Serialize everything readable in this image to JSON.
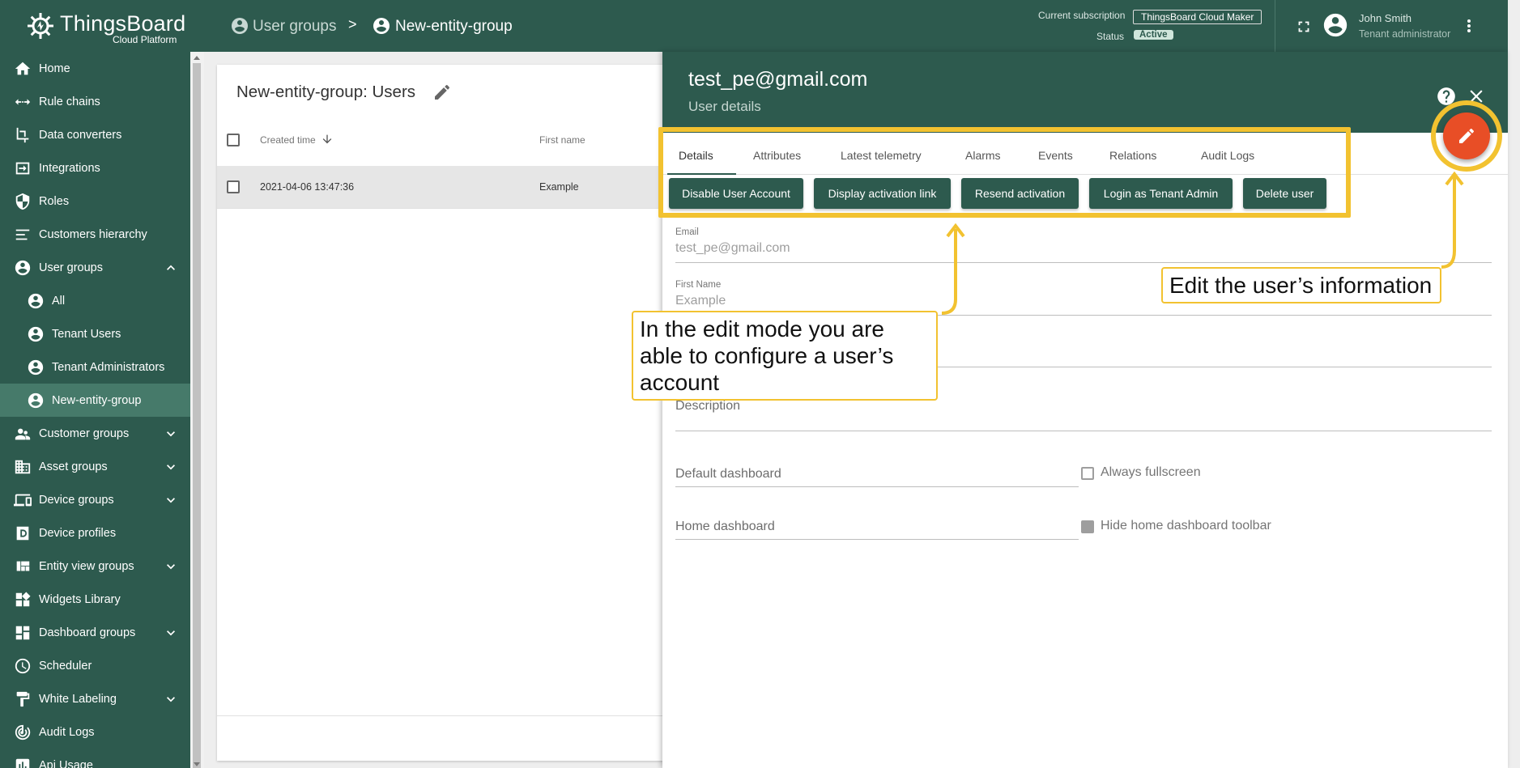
{
  "brand": {
    "name": "ThingsBoard",
    "subtitle": "Cloud Platform"
  },
  "sidebar": {
    "items": [
      {
        "label": "Home",
        "icon": "home-icon"
      },
      {
        "label": "Rule chains",
        "icon": "rule-chain-icon"
      },
      {
        "label": "Data converters",
        "icon": "converter-icon"
      },
      {
        "label": "Integrations",
        "icon": "integration-icon"
      },
      {
        "label": "Roles",
        "icon": "shield-icon"
      },
      {
        "label": "Customers hierarchy",
        "icon": "hierarchy-icon"
      },
      {
        "label": "User groups",
        "icon": "account-circle-icon",
        "expanded": true
      },
      {
        "label": "All",
        "icon": "account-circle-icon"
      },
      {
        "label": "Tenant Users",
        "icon": "account-circle-icon"
      },
      {
        "label": "Tenant Administrators",
        "icon": "account-circle-icon"
      },
      {
        "label": "New-entity-group",
        "icon": "account-circle-icon",
        "active": true
      },
      {
        "label": "Customer groups",
        "icon": "supervisor-icon"
      },
      {
        "label": "Asset groups",
        "icon": "domain-icon"
      },
      {
        "label": "Device groups",
        "icon": "devices-icon"
      },
      {
        "label": "Device profiles",
        "icon": "device-profile-icon"
      },
      {
        "label": "Entity view groups",
        "icon": "view-quilt-icon"
      },
      {
        "label": "Widgets Library",
        "icon": "widgets-icon"
      },
      {
        "label": "Dashboard groups",
        "icon": "dashboard-icon"
      },
      {
        "label": "Scheduler",
        "icon": "schedule-icon"
      },
      {
        "label": "White Labeling",
        "icon": "format-paint-icon"
      },
      {
        "label": "Audit Logs",
        "icon": "track-changes-icon"
      },
      {
        "label": "Api Usage",
        "icon": "insert-chart-icon"
      }
    ]
  },
  "topbar": {
    "breadcrumb": [
      "User groups",
      ">",
      "New-entity-group"
    ],
    "subscription_label": "Current subscription",
    "subscription_value": "ThingsBoard Cloud Maker",
    "status_label": "Status",
    "status_value": "Active",
    "user_name": "John Smith",
    "user_role": "Tenant administrator"
  },
  "table": {
    "title": "New-entity-group: Users",
    "columns": [
      "Created time",
      "First name"
    ],
    "rows": [
      {
        "created": "2021-04-06 13:47:36",
        "first_name": "Example"
      }
    ]
  },
  "panel": {
    "title": "test_pe@gmail.com",
    "subtitle": "User details",
    "tabs": [
      "Details",
      "Attributes",
      "Latest telemetry",
      "Alarms",
      "Events",
      "Relations",
      "Audit Logs"
    ],
    "actions": [
      "Disable User Account",
      "Display activation link",
      "Resend activation",
      "Login as Tenant Admin",
      "Delete user"
    ],
    "email_label": "Email",
    "email_value": "test_pe@gmail.com",
    "first_name_label": "First Name",
    "first_name_value": "Example",
    "description_label": "Description",
    "default_dashboard_label": "Default dashboard",
    "always_fullscreen_label": "Always fullscreen",
    "home_dashboard_label": "Home dashboard",
    "hide_toolbar_label": "Hide home dashboard toolbar",
    "hide_toolbar_checked": true,
    "always_fullscreen_checked": false
  },
  "callouts": {
    "edit_mode": "In the edit mode you are able to configure a user’s account",
    "edit_info": "Edit the user’s information"
  },
  "colors": {
    "primary": "#2d5a4e",
    "accent": "#e84e26",
    "highlight": "#f2c230"
  }
}
